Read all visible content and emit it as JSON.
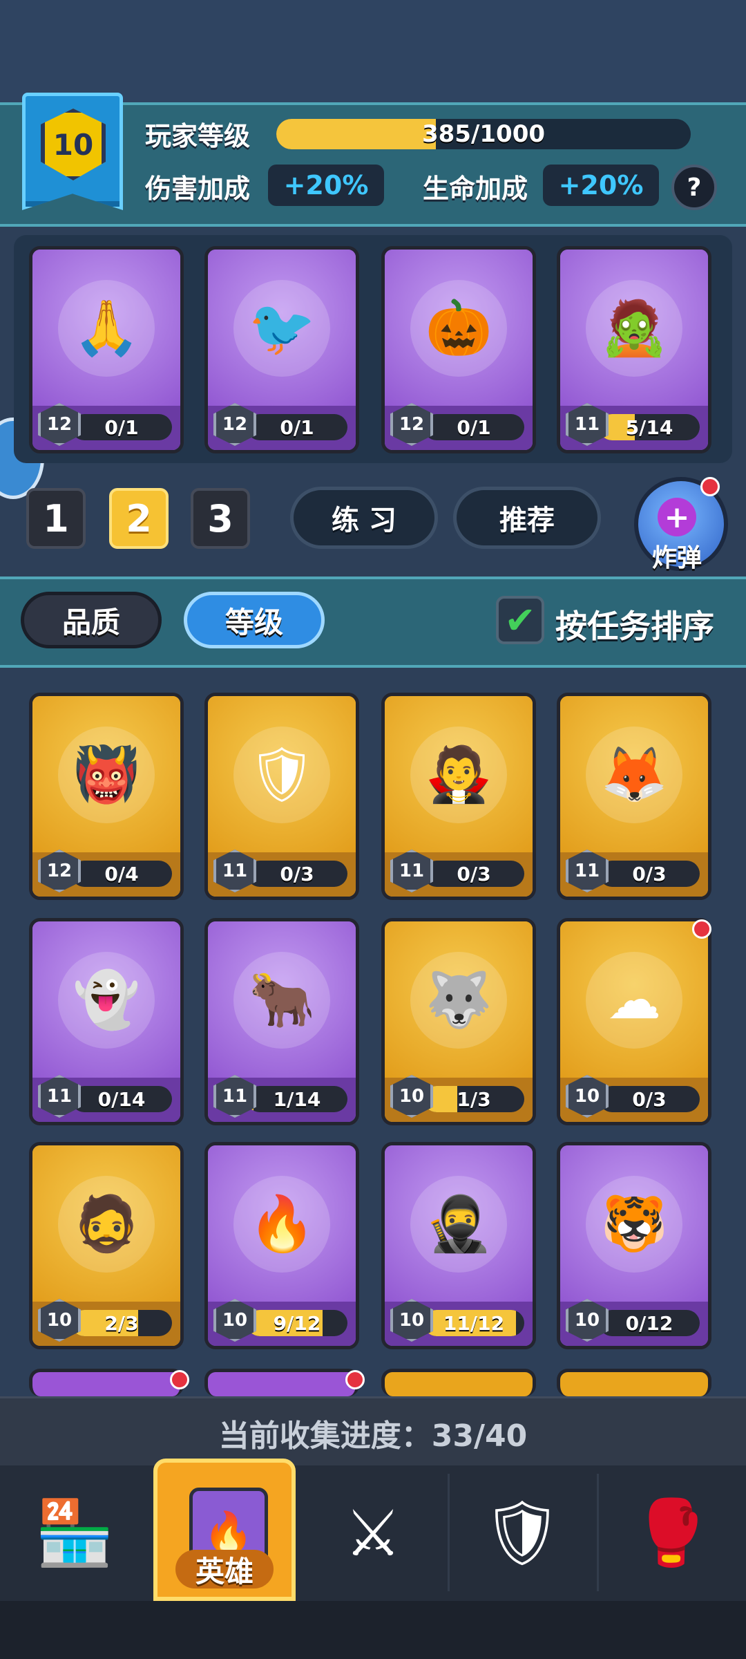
{
  "player": {
    "level": "10",
    "level_label": "玩家等级",
    "xp_text": "385/1000",
    "xp_fraction": 0.385
  },
  "bonus": {
    "damage_label": "伤害加成",
    "damage_value": "+20%",
    "life_label": "生命加成",
    "life_value": "+20%",
    "help": "?"
  },
  "deck": [
    {
      "level": "12",
      "progress": "0/1",
      "fraction": 0,
      "color": "purple",
      "icon": "🙏"
    },
    {
      "level": "12",
      "progress": "0/1",
      "fraction": 0,
      "color": "purple",
      "icon": "🐦"
    },
    {
      "level": "12",
      "progress": "0/1",
      "fraction": 0,
      "color": "purple",
      "icon": "🎃"
    },
    {
      "level": "11",
      "progress": "5/14",
      "fraction": 0.357,
      "color": "purple",
      "icon": "🧟"
    }
  ],
  "deck_tabs": [
    "1",
    "2",
    "3"
  ],
  "deck_actions": {
    "practice": "练 习",
    "recommend": "推荐",
    "bomb": "炸弹"
  },
  "sort": {
    "quality": "品质",
    "level": "等级",
    "by_task": "按任务排序"
  },
  "collection": [
    {
      "level": "12",
      "progress": "0/4",
      "fraction": 0,
      "color": "gold",
      "icon": "👹"
    },
    {
      "level": "11",
      "progress": "0/3",
      "fraction": 0,
      "color": "gold",
      "icon": "🛡"
    },
    {
      "level": "11",
      "progress": "0/3",
      "fraction": 0,
      "color": "gold",
      "icon": "🧛"
    },
    {
      "level": "11",
      "progress": "0/3",
      "fraction": 0,
      "color": "gold",
      "icon": "🦊"
    },
    {
      "level": "11",
      "progress": "0/14",
      "fraction": 0,
      "color": "purple",
      "icon": "👻"
    },
    {
      "level": "11",
      "progress": "1/14",
      "fraction": 0.071,
      "color": "purple",
      "icon": "🐂"
    },
    {
      "level": "10",
      "progress": "1/3",
      "fraction": 0.333,
      "color": "gold",
      "icon": "🐺"
    },
    {
      "level": "10",
      "progress": "0/3",
      "fraction": 0,
      "color": "gold",
      "icon": "☁",
      "dot": true
    },
    {
      "level": "10",
      "progress": "2/3",
      "fraction": 0.667,
      "color": "gold",
      "icon": "🧔"
    },
    {
      "level": "10",
      "progress": "9/12",
      "fraction": 0.75,
      "color": "purple",
      "icon": "🔥"
    },
    {
      "level": "10",
      "progress": "11/12",
      "fraction": 0.917,
      "color": "purple",
      "icon": "🥷"
    },
    {
      "level": "10",
      "progress": "0/12",
      "fraction": 0,
      "color": "purple",
      "icon": "🐯"
    }
  ],
  "collection_progress": "当前收集进度：33/40",
  "nav": {
    "shop_icon": "🏪",
    "hero_label": "英雄",
    "hero_icon": "🔥",
    "battle_icon": "⚔",
    "guild_icon": "🛡",
    "event_icon": "🥊"
  },
  "colors": {
    "gold": "#e9a51d",
    "purple": "#9a55d6",
    "accent_blue": "#3fc7ff",
    "bar": "#f5c53c"
  }
}
